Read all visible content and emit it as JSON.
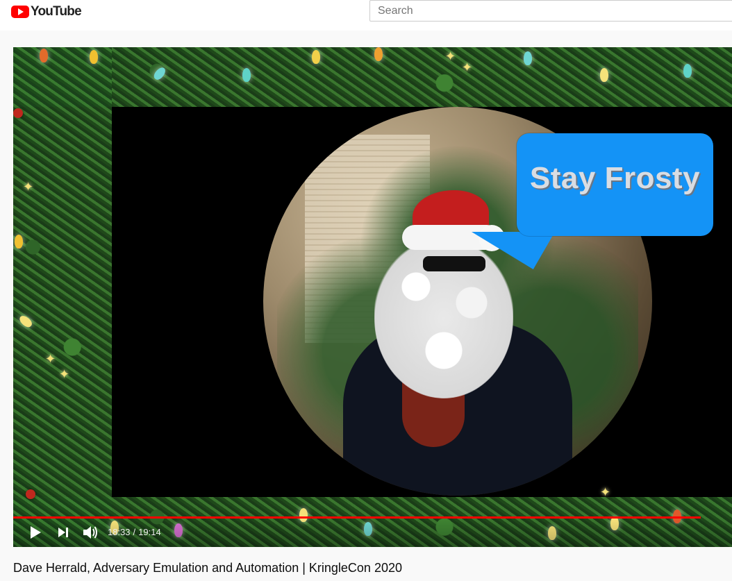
{
  "masthead": {
    "logo_text": "YouTube",
    "logo_icon": "youtube-play-logo-icon",
    "search": {
      "placeholder": "Search",
      "value": ""
    }
  },
  "player": {
    "speech_bubble_text": "Stay Frosty",
    "progress_fraction": 0.957,
    "controls": {
      "play_icon": "play-icon",
      "next_icon": "next-track-icon",
      "volume_icon": "volume-icon",
      "current_time": "18:33",
      "separator": "/",
      "duration": "19:14"
    }
  },
  "video": {
    "title": "Dave Herrald, Adversary Emulation and Automation | KringleCon 2020"
  },
  "colors": {
    "brand_red": "#ff0000",
    "bubble_blue": "#1493f6",
    "page_bg": "#f9f9f9",
    "title_text": "#0d0d0d"
  }
}
